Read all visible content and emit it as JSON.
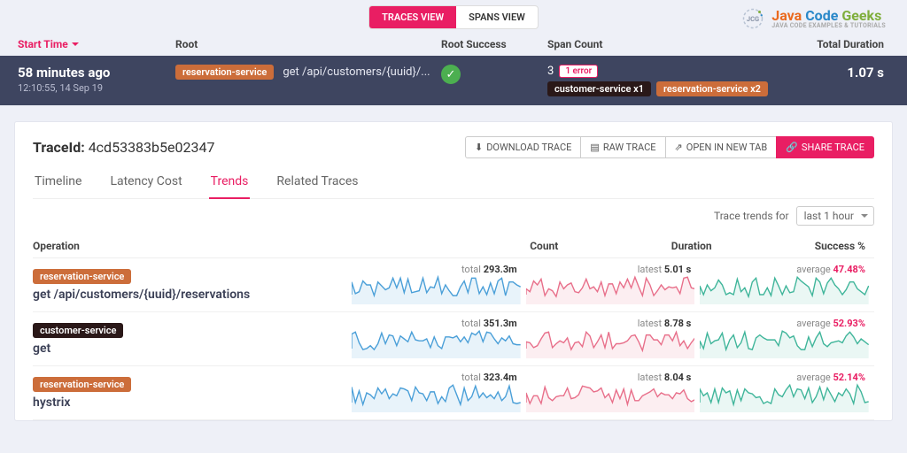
{
  "toggle": {
    "traces": "TRACES VIEW",
    "spans": "SPANS VIEW"
  },
  "logo": {
    "line1_java": "Java",
    "line1_code": "Code",
    "line1_geeks": "Geeks",
    "line2": "JAVA CODE EXAMPLES & TUTORIALS"
  },
  "cols": {
    "start": "Start Time",
    "root": "Root",
    "success": "Root Success",
    "span": "Span Count",
    "dur": "Total Duration"
  },
  "bar": {
    "time": "58 minutes ago",
    "ts": "12:10:55, 14 Sep 19",
    "svc": "reservation-service",
    "ep": "get /api/customers/{uuid}/...",
    "count": "3",
    "err": "1 error",
    "tag1": "customer-service x1",
    "tag2": "reservation-service x2",
    "dur": "1.07 s"
  },
  "trace": {
    "label": "TraceId:",
    "id": "4cd53383b5e02347"
  },
  "buttons": {
    "dl": "DOWNLOAD TRACE",
    "raw": "RAW TRACE",
    "open": "OPEN IN NEW TAB",
    "share": "SHARE TRACE"
  },
  "tabs": [
    "Timeline",
    "Latency Cost",
    "Trends",
    "Related Traces"
  ],
  "range": {
    "label": "Trace trends for",
    "value": "last 1 hour"
  },
  "ghead": {
    "op": "Operation",
    "count": "Count",
    "dur": "Duration",
    "suc": "Success %"
  },
  "ops": [
    {
      "svc": "reservation-service",
      "svcClass": "b-orange",
      "name": "get /api/customers/{uuid}/reservations",
      "count_l": "total",
      "count_v": "293.3m",
      "dur_l": "latest",
      "dur_v": "5.01 s",
      "suc_l": "average",
      "suc_v": "47.48%"
    },
    {
      "svc": "customer-service",
      "svcClass": "b-dark",
      "name": "get",
      "count_l": "total",
      "count_v": "351.3m",
      "dur_l": "latest",
      "dur_v": "8.78 s",
      "suc_l": "average",
      "suc_v": "52.93%"
    },
    {
      "svc": "reservation-service",
      "svcClass": "b-orange",
      "name": "hystrix",
      "count_l": "total",
      "count_v": "323.4m",
      "dur_l": "latest",
      "dur_v": "8.04 s",
      "suc_l": "average",
      "suc_v": "52.14%"
    }
  ],
  "chart_data": {
    "type": "line",
    "note": "sparkline trends per operation over last 1 hour; exact values unlabeled, shapes only",
    "series": [
      {
        "op": 0,
        "metric": "count",
        "color": "#4a9fd8"
      },
      {
        "op": 0,
        "metric": "duration",
        "color": "#e86f8a"
      },
      {
        "op": 0,
        "metric": "success",
        "color": "#3fb59a"
      },
      {
        "op": 1,
        "metric": "count",
        "color": "#4a9fd8"
      },
      {
        "op": 1,
        "metric": "duration",
        "color": "#e86f8a"
      },
      {
        "op": 1,
        "metric": "success",
        "color": "#3fb59a"
      },
      {
        "op": 2,
        "metric": "count",
        "color": "#4a9fd8"
      },
      {
        "op": 2,
        "metric": "duration",
        "color": "#e86f8a"
      },
      {
        "op": 2,
        "metric": "success",
        "color": "#3fb59a"
      }
    ]
  }
}
